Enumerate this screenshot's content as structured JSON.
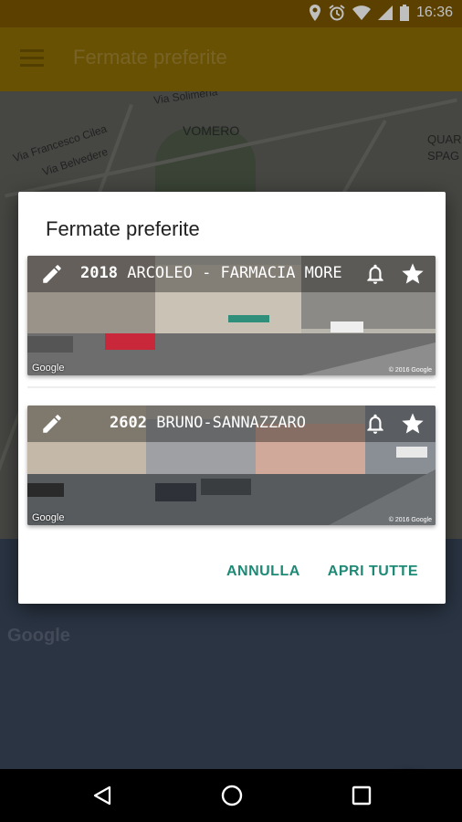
{
  "status_bar": {
    "time": "16:36",
    "icons": [
      "location-icon",
      "alarm-icon",
      "wifi-icon",
      "signal-icon",
      "battery-icon"
    ]
  },
  "app_bar": {
    "title": "Fermate preferite",
    "menu_icon": "hamburger-menu-icon"
  },
  "map": {
    "labels": [
      "Via Solimena",
      "VOMERO",
      "Via Francesco Cilea",
      "Via Belvedere",
      "QUAR",
      "SPAG"
    ],
    "logo": "Google"
  },
  "fab": {
    "label": "+"
  },
  "dialog": {
    "title": "Fermate preferite",
    "stops": [
      {
        "number": "2018",
        "name": "ARCOLEO - FARMACIA MORE",
        "google": "Google",
        "copyright": "© 2016 Google"
      },
      {
        "number": "2602",
        "name": "BRUNO-SANNAZZARO",
        "google": "Google",
        "copyright": "© 2016 Google"
      }
    ],
    "cancel_label": "ANNULLA",
    "open_all_label": "APRI TUTTE"
  },
  "colors": {
    "status_bar": "#7a5600",
    "app_bar": "#8d6d05",
    "accent": "#1e8a76",
    "fab": "#866507"
  }
}
